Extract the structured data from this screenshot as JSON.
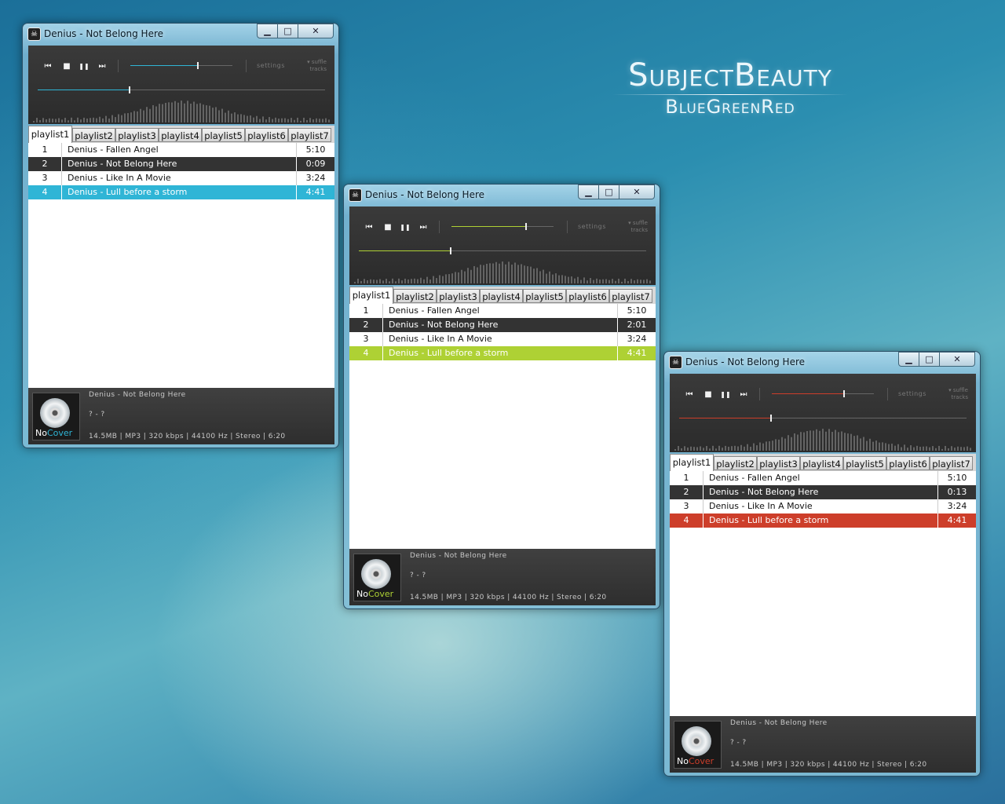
{
  "brand": {
    "title": "SubjectBeauty",
    "subtitle": "BlueGreenRed"
  },
  "windows": [
    {
      "accent": "#2fb5d6",
      "title": "Denius - Not Belong Here",
      "volume": 0.66,
      "seek": 0.32,
      "playing_time": "0:09"
    },
    {
      "accent": "#aed134",
      "title": "Denius - Not Belong Here",
      "volume": 0.73,
      "seek": 0.32,
      "playing_time": "2:01"
    },
    {
      "accent": "#cd3e2a",
      "title": "Denius - Not Belong Here",
      "volume": 0.71,
      "seek": 0.32,
      "playing_time": "0:13"
    }
  ],
  "controls": {
    "minimize": "▁",
    "maximize": "□",
    "close": "✕"
  },
  "transport": {
    "prev": "⏮",
    "stop": "■",
    "pause": "❚❚",
    "next": "⏭"
  },
  "settings_label": "settings",
  "shuffle_label": "suffle",
  "tracks_label": "tracks",
  "tabs": [
    "playlist1",
    "playlist2",
    "playlist3",
    "playlist4",
    "playlist5",
    "playlist6",
    "playlist7"
  ],
  "tracks": [
    {
      "num": "1",
      "title": "Denius - Fallen Angel",
      "duration": "5:10"
    },
    {
      "num": "2",
      "title": "Denius - Not Belong Here",
      "duration": "0:09"
    },
    {
      "num": "3",
      "title": "Denius - Like In A Movie",
      "duration": "3:24"
    },
    {
      "num": "4",
      "title": "Denius - Lull before a storm",
      "duration": "4:41"
    }
  ],
  "now_playing": {
    "title": "Denius - Not Belong Here",
    "artist_album": "? - ?",
    "details": "14.5MB | MP3 | 320 kbps | 44100 Hz | Stereo | 6:20"
  },
  "cover": {
    "no": "No",
    "cover": "Cover"
  }
}
